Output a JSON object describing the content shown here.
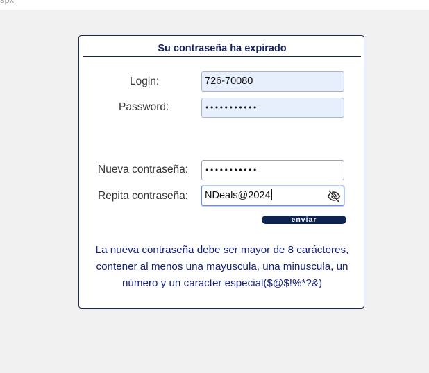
{
  "browser": {
    "url_fragment": "spx"
  },
  "form": {
    "title": "Su contraseña ha expirado",
    "login_label": "Login:",
    "login_value": "726-70080",
    "password_label": "Password:",
    "password_value": "•••••••••••",
    "new_password_label": "Nueva contraseña:",
    "new_password_value": "•••••••••••",
    "repeat_password_label": "Repita contraseña:",
    "repeat_password_value": "NDeals@2024",
    "submit_label": "enviar",
    "hint_line1": "La nueva contraseña debe ser mayor de 8 carácteres,",
    "hint_line2": "contener al menos una mayuscula, una minuscula, un",
    "hint_line3": "número y un caracter especial($@$!%*?&)"
  },
  "icons": {
    "toggle_visibility": "eye-slash-icon"
  },
  "colors": {
    "accent": "#14215a",
    "hint_text": "#14217a",
    "autofill_bg": "#e8effc",
    "button_bg": "#0f2350"
  }
}
